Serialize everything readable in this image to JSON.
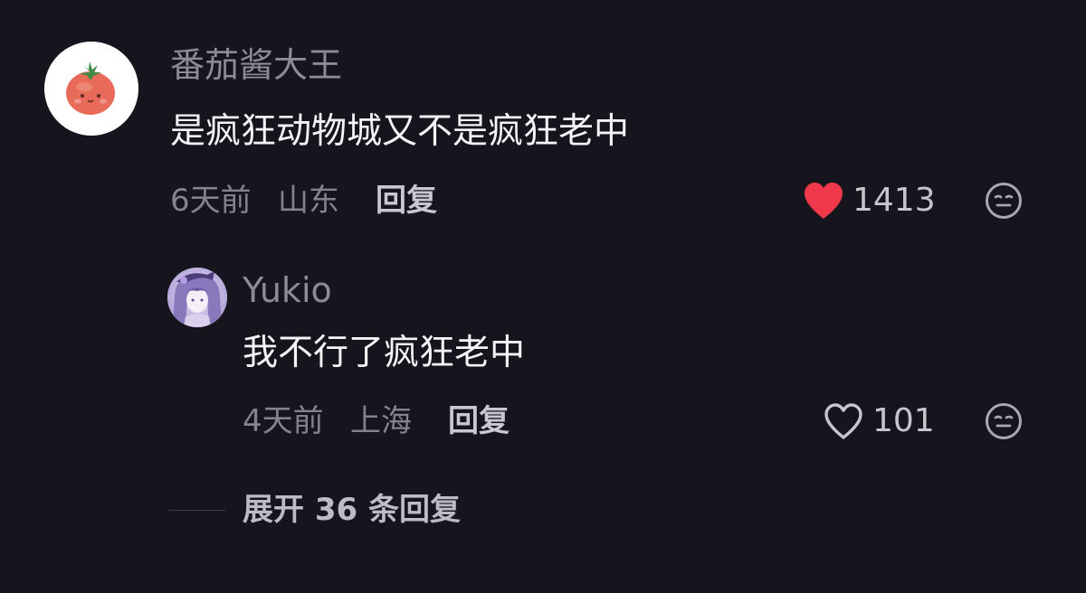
{
  "comment": {
    "username": "番茄酱大王",
    "text": "是疯狂动物城又不是疯狂老中",
    "time": "6天前",
    "location": "山东",
    "reply_label": "回复",
    "like_count": "1413",
    "liked": true,
    "avatar_icon": "tomato-avatar"
  },
  "reply": {
    "username": "Yukio",
    "text": "我不行了疯狂老中",
    "time": "4天前",
    "location": "上海",
    "reply_label": "回复",
    "like_count": "101",
    "liked": false,
    "avatar_icon": "anime-girl-avatar"
  },
  "expand_label": "展开 36 条回复",
  "colors": {
    "background": "#16141d",
    "like_red": "#f0384b",
    "muted_text": "#84828b"
  }
}
